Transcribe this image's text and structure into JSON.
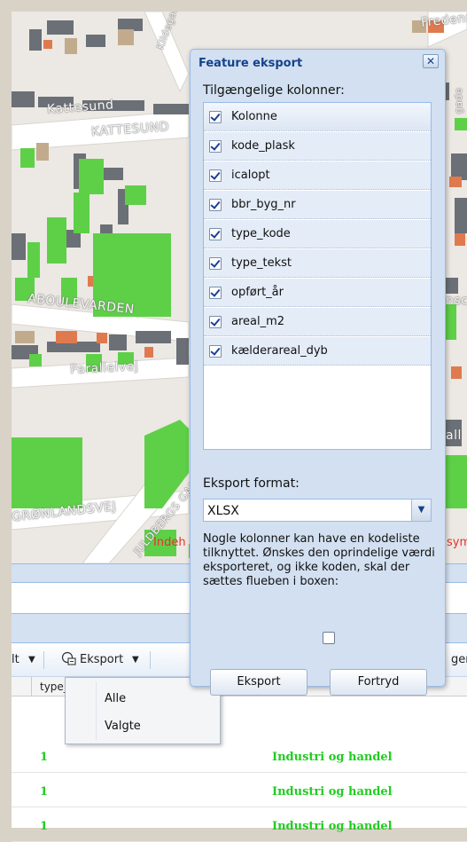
{
  "map": {
    "street_labels": [
      "Fredensgade",
      "Kattesund",
      "KATTESUND",
      "ABOULEVARDEN",
      "Parallelvej",
      "GRØNLANDSVEJ",
      "JULDBERGS GADE",
      "Kildegade",
      "gade",
      "nsc",
      "all"
    ],
    "partial_red_labels": [
      "Indeh",
      "sym"
    ]
  },
  "colors": {
    "building_green": "#5ed048",
    "building_dark": "#6b6f76",
    "building_orange": "#df7a4f",
    "building_tan": "#c2ab8d",
    "window_bg": "#d2e0f1",
    "title_color": "#15428b"
  },
  "window": {
    "title": "Feature eksport",
    "close_icon": "close-icon",
    "available_columns_label": "Tilgængelige kolonner:",
    "columns_header": "Kolonne",
    "columns": [
      {
        "name": "kode_plask",
        "checked": true
      },
      {
        "name": "icalopt",
        "checked": true
      },
      {
        "name": "bbr_byg_nr",
        "checked": true
      },
      {
        "name": "type_kode",
        "checked": true
      },
      {
        "name": "type_tekst",
        "checked": true
      },
      {
        "name": "opført_år",
        "checked": true
      },
      {
        "name": "areal_m2",
        "checked": true
      },
      {
        "name": "kælderareal_dyb",
        "checked": true
      }
    ],
    "format_label": "Eksport format:",
    "format_value": "XLSX",
    "note": "Nogle kolonner kan have en kodeliste tilknyttet. Ønskes den oprindelige værdi eksporteret, og ikke koden, skal der sættes flueben i boxen:",
    "flag_checked": false,
    "export_button": "Eksport",
    "cancel_button": "Fortryd"
  },
  "toolbar": {
    "left_fragment": "lt",
    "export_label": "Eksport",
    "right_fragment": "ger"
  },
  "export_menu": {
    "items": [
      "Alle",
      "Valgte"
    ]
  },
  "grid": {
    "header_col1": "type_",
    "rows": [
      {
        "col1": "1",
        "col2": "Industri og handel"
      },
      {
        "col1": "1",
        "col2": "Industri og handel"
      },
      {
        "col1": "1",
        "col2": "Industri og handel"
      }
    ]
  }
}
